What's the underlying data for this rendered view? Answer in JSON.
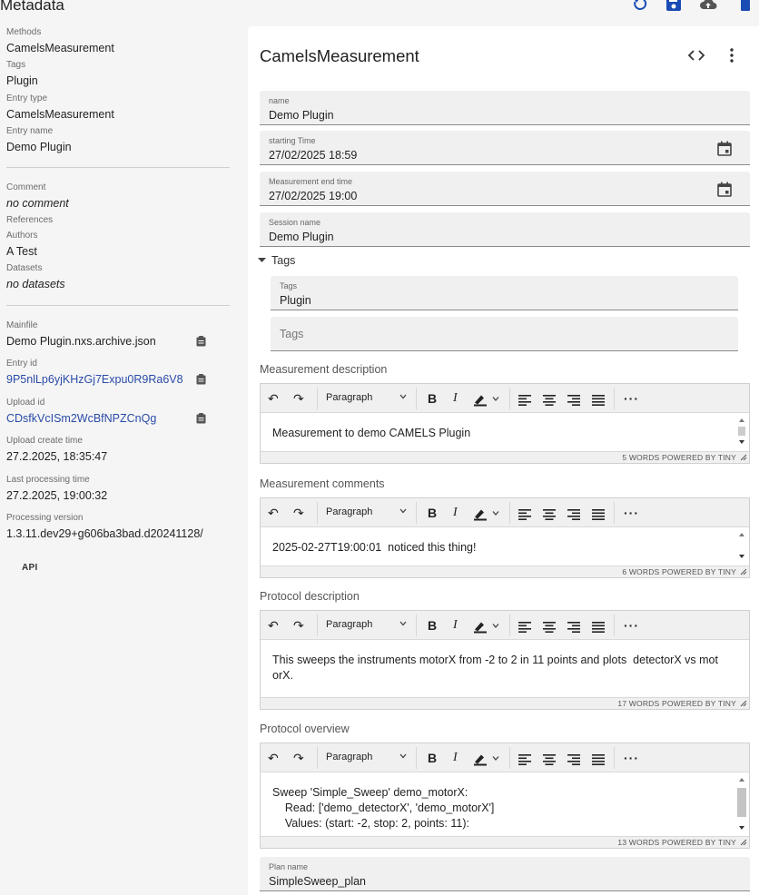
{
  "metadata": {
    "title": "Metadata",
    "methods_label": "Methods",
    "methods_value": "CamelsMeasurement",
    "tags_label": "Tags",
    "tags_value": "Plugin",
    "entry_type_label": "Entry type",
    "entry_type_value": "CamelsMeasurement",
    "entry_name_label": "Entry name",
    "entry_name_value": "Demo Plugin",
    "comment_label": "Comment",
    "comment_value": "no comment",
    "references_label": "References",
    "authors_label": "Authors",
    "authors_value": "A Test",
    "datasets_label": "Datasets",
    "datasets_value": "no datasets",
    "mainfile_label": "Mainfile",
    "mainfile_value": "Demo Plugin.nxs.archive.json",
    "entry_id_label": "Entry id",
    "entry_id_value": "9P5nlLp6yjKHzGj7Expu0R9Ra6V8",
    "upload_id_label": "Upload id",
    "upload_id_value": "CDsfkVcISm2WcBfNPZCnQg",
    "upload_create_label": "Upload create time",
    "upload_create_value": "27.2.2025, 18:35:47",
    "last_processing_label": "Last processing time",
    "last_processing_value": "27.2.2025, 19:00:32",
    "processing_version_label": "Processing version",
    "processing_version_value": "1.3.11.dev29+g606ba3bad.d20241128/",
    "api_label": "API"
  },
  "panel": {
    "title": "CamelsMeasurement",
    "fields": {
      "name": {
        "label": "name",
        "value": "Demo Plugin"
      },
      "start": {
        "label": "starting Time",
        "value": "27/02/2025 18:59"
      },
      "end": {
        "label": "Measurement end time",
        "value": "27/02/2025 19:00"
      },
      "session": {
        "label": "Session name",
        "value": "Demo Plugin"
      },
      "plan": {
        "label": "Plan name",
        "value": "SimpleSweep_plan"
      }
    },
    "tags_section": "Tags",
    "tags_field": {
      "label": "Tags",
      "value": "Plugin",
      "placeholder": "Tags"
    },
    "toolbar": {
      "paragraph": "Paragraph"
    },
    "editors": {
      "desc": {
        "label": "Measurement description",
        "lines": [
          "Measurement to demo CAMELS Plugin"
        ],
        "status": "5 WORDS  POWERED BY TINY"
      },
      "comments": {
        "label": "Measurement comments",
        "lines": [
          "2025-02-27T19:00:01  noticed this thing!"
        ],
        "status": "6 WORDS  POWERED BY TINY"
      },
      "protocol": {
        "label": "Protocol description",
        "lines": [
          "This sweeps the instruments motorX from -2 to 2 in 11 points and plots  detectorX vs mot",
          "orX."
        ],
        "status": "17 WORDS  POWERED BY TINY"
      },
      "overview": {
        "label": "Protocol overview",
        "lines": [
          "Sweep 'Simple_Sweep' demo_motorX:",
          "    Read: ['demo_detectorX', 'demo_motorX']",
          "    Values: (start: -2, stop: 2, points: 11):"
        ],
        "status": "13 WORDS  POWERED BY TINY"
      }
    }
  },
  "colors": {
    "link": "#2a4ba8",
    "accent": "#1a4bb5"
  }
}
